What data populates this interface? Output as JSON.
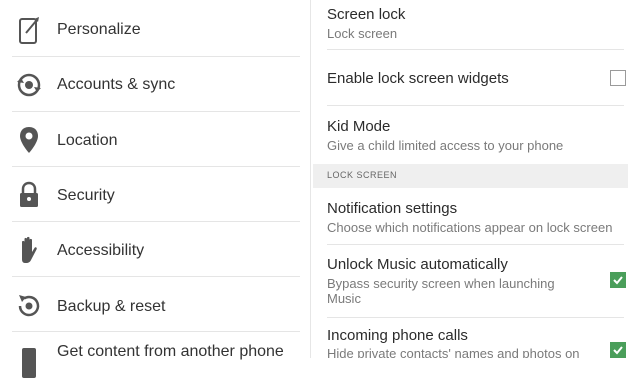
{
  "left_menu": {
    "items": [
      {
        "label": "Personalize",
        "icon": "personalize-icon"
      },
      {
        "label": "Accounts & sync",
        "icon": "sync-icon"
      },
      {
        "label": "Location",
        "icon": "location-pin-icon"
      },
      {
        "label": "Security",
        "icon": "lock-icon"
      },
      {
        "label": "Accessibility",
        "icon": "hand-icon"
      },
      {
        "label": "Backup & reset",
        "icon": "backup-icon"
      },
      {
        "label": "Get content from another phone",
        "icon": "phone-icon"
      }
    ]
  },
  "settings": {
    "screen_lock": {
      "title": "Screen lock",
      "subtitle": "Lock screen"
    },
    "lock_widgets": {
      "title": "Enable lock screen widgets",
      "checked": false
    },
    "kid_mode": {
      "title": "Kid Mode",
      "subtitle": "Give a child limited access to your phone"
    },
    "section_header": "LOCK SCREEN",
    "notification_settings": {
      "title": "Notification settings",
      "subtitle": "Choose which notifications appear on lock screen"
    },
    "unlock_music": {
      "title": "Unlock Music automatically",
      "subtitle_line1": "Bypass security screen when launching",
      "subtitle_line2": "Music",
      "checked": true
    },
    "incoming_calls": {
      "title": "Incoming phone calls",
      "subtitle": "Hide private contacts' names and photos on",
      "checked": true
    }
  },
  "colors": {
    "accent": "#4a9e5a",
    "icon": "#555555",
    "section_bg": "#efefef"
  }
}
